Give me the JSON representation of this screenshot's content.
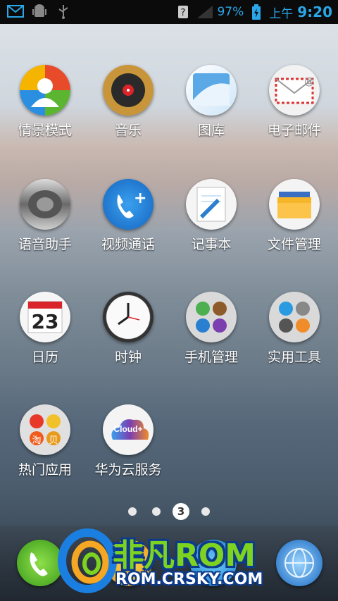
{
  "status_bar": {
    "battery": "97%",
    "ampm": "上午",
    "time": "9:20",
    "icons": [
      "email-notification-icon",
      "android-debug-icon",
      "usb-icon",
      "sim-unknown-icon",
      "signal-icon",
      "battery-icon"
    ]
  },
  "apps": [
    {
      "label": "情景模式",
      "icon": "profiles-icon"
    },
    {
      "label": "音乐",
      "icon": "music-icon"
    },
    {
      "label": "图库",
      "icon": "gallery-icon"
    },
    {
      "label": "电子邮件",
      "icon": "email-icon"
    },
    {
      "label": "语音助手",
      "icon": "voice-assistant-icon"
    },
    {
      "label": "视频通话",
      "icon": "video-call-icon"
    },
    {
      "label": "记事本",
      "icon": "notepad-icon"
    },
    {
      "label": "文件管理",
      "icon": "file-manager-icon"
    },
    {
      "label": "日历",
      "icon": "calendar-icon",
      "date": "23"
    },
    {
      "label": "时钟",
      "icon": "clock-icon"
    },
    {
      "label": "手机管理",
      "icon": "phone-manager-icon"
    },
    {
      "label": "实用工具",
      "icon": "tools-icon"
    },
    {
      "label": "热门应用",
      "icon": "hot-apps-icon",
      "badges": [
        "淘",
        "贝"
      ]
    },
    {
      "label": "华为云服务",
      "icon": "cloud-service-icon",
      "badge": "Cloud+"
    }
  ],
  "page_indicator": {
    "current": "3",
    "total": 4
  },
  "dock": {
    "icons": [
      "phone-icon",
      "contacts-icon",
      "messages-icon",
      "browser-icon"
    ]
  },
  "watermark": {
    "title": "非凡ROM",
    "url": "ROM.CRSKY.COM"
  },
  "colors": {
    "status_accent": "#2aa7e8",
    "watermark_green": "#7ed321",
    "watermark_blue": "#0d3b8c"
  }
}
